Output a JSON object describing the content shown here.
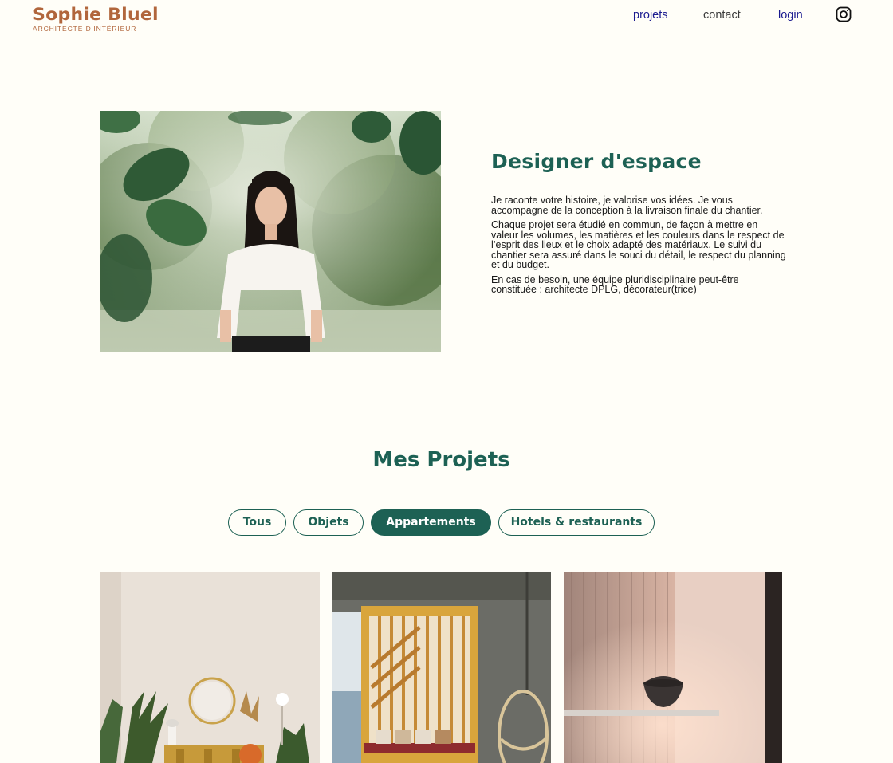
{
  "header": {
    "brand": "Sophie Bluel",
    "tagline": "ARCHITECTE D’INTÉRIEUR",
    "nav": {
      "projets": "projets",
      "contact": "contact",
      "login": "login",
      "instagram_icon": "instagram-icon"
    }
  },
  "introduction": {
    "title": "Designer d'espace",
    "paragraphs": [
      "Je raconte votre histoire, je valorise vos idées. Je vous accompagne de la conception à la livraison finale du chantier.",
      "Chaque projet sera étudié en commun, de façon à mettre en valeur les volumes, les matières et les couleurs dans le respect de l’esprit des lieux et le choix adapté des matériaux. Le suivi du chantier sera assuré dans le souci du détail, le respect du planning et du budget.",
      "En cas de besoin, une équipe pluridisciplinaire peut-être constituée : architecte DPLG, décorateur(trice)"
    ]
  },
  "portfolio": {
    "title": "Mes Projets",
    "filters": [
      {
        "label": "Tous",
        "active": false
      },
      {
        "label": "Objets",
        "active": false
      },
      {
        "label": "Appartements",
        "active": true
      },
      {
        "label": "Hotels & restaurants",
        "active": false
      }
    ]
  },
  "colors": {
    "brand": "#B1663C",
    "accent": "#1D6154",
    "background": "#FFFEF8"
  }
}
